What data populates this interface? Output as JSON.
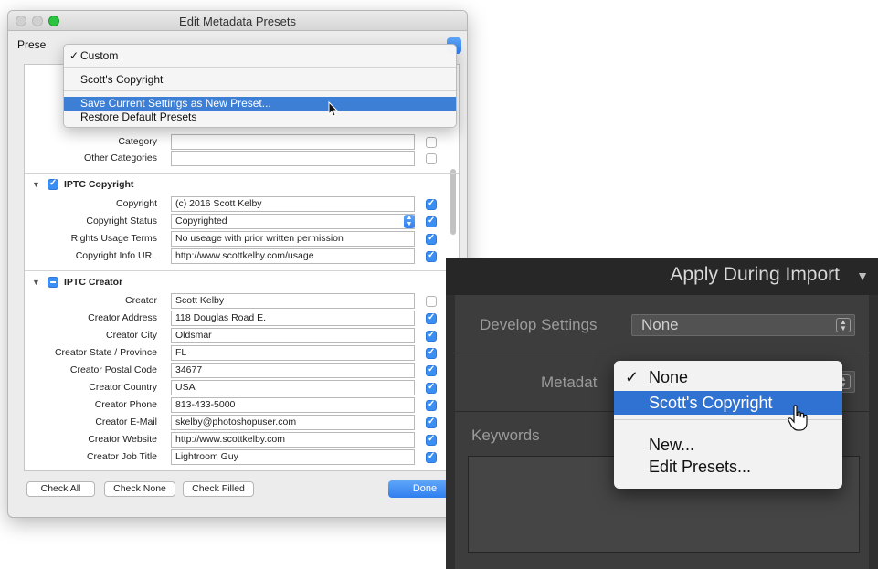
{
  "dialog": {
    "title": "Edit Metadata Presets",
    "preset_label": "Prese",
    "preset_menu": {
      "items": [
        {
          "label": "Custom",
          "checked": true
        },
        {
          "label": "Scott's Copyright"
        },
        {
          "label": "Save Current Settings as New Preset...",
          "highlighted": true
        },
        {
          "label": "Restore Default Presets"
        }
      ]
    },
    "basic_fields": [
      {
        "label": "Category",
        "value": "",
        "checked": false
      },
      {
        "label": "Other Categories",
        "value": "",
        "checked": false
      }
    ],
    "iptc_copyright": {
      "title": "IPTC Copyright",
      "fields": [
        {
          "label": "Copyright",
          "value": "(c) 2016 Scott Kelby",
          "checked": true
        },
        {
          "label": "Copyright Status",
          "value": "Copyrighted",
          "checked": true,
          "select": true
        },
        {
          "label": "Rights Usage Terms",
          "value": "No useage with prior written permission",
          "checked": true
        },
        {
          "label": "Copyright Info URL",
          "value": "http://www.scottkelby.com/usage",
          "checked": true
        }
      ]
    },
    "iptc_creator": {
      "title": "IPTC Creator",
      "fields": [
        {
          "label": "Creator",
          "value": "Scott Kelby",
          "checked": false
        },
        {
          "label": "Creator Address",
          "value": "118 Douglas Road E.",
          "checked": true
        },
        {
          "label": "Creator City",
          "value": "Oldsmar",
          "checked": true
        },
        {
          "label": "Creator State / Province",
          "value": "FL",
          "checked": true
        },
        {
          "label": "Creator Postal Code",
          "value": "34677",
          "checked": true
        },
        {
          "label": "Creator Country",
          "value": "USA",
          "checked": true
        },
        {
          "label": "Creator Phone",
          "value": "813-433-5000",
          "checked": true
        },
        {
          "label": "Creator E-Mail",
          "value": "skelby@photoshopuser.com",
          "checked": true
        },
        {
          "label": "Creator Website",
          "value": "http://www.scottkelby.com",
          "checked": true
        },
        {
          "label": "Creator Job Title",
          "value": "Lightroom Guy",
          "checked": true
        }
      ]
    },
    "buttons": {
      "check_all": "Check All",
      "check_none": "Check None",
      "check_filled": "Check Filled",
      "done": "Done"
    }
  },
  "lightroom": {
    "header_title": "Apply During Import",
    "develop_settings_label": "Develop Settings",
    "develop_settings_value": "None",
    "metadata_label": "Metadat",
    "keywords_label": "Keywords",
    "metadata_menu": {
      "items": [
        {
          "label": "None",
          "checked": true
        },
        {
          "label": "Scott's Copyright",
          "highlighted": true
        },
        {
          "label": "New..."
        },
        {
          "label": "Edit Presets..."
        }
      ]
    }
  },
  "colors": {
    "mac_accent": "#3b8ef2",
    "lr_highlight": "#2f72d1",
    "lr_panel": "#3d3d3d"
  }
}
